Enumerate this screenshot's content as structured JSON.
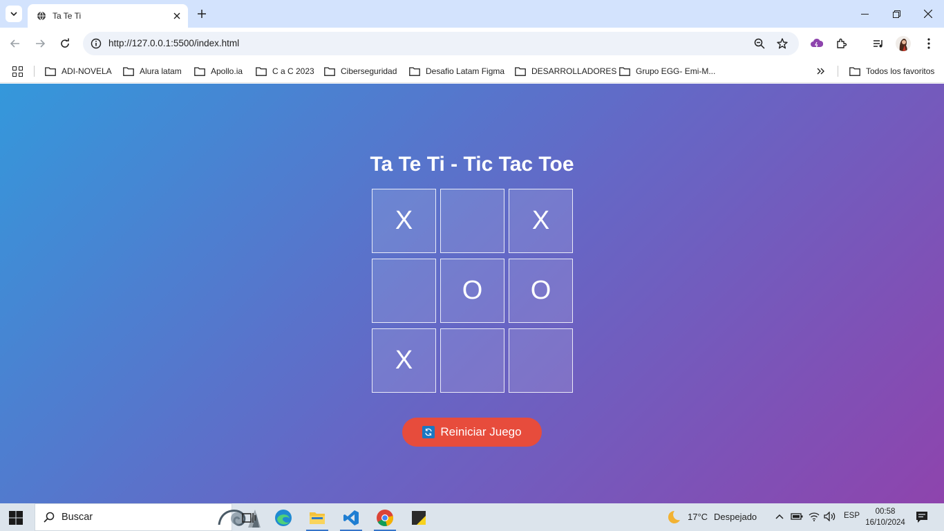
{
  "browser": {
    "tab_title": "Ta Te Ti",
    "url": "http://127.0.0.1:5500/index.html",
    "bookmarks": [
      "ADI-NOVELA",
      "Alura latam",
      "Apollo.ia",
      "C a C 2023",
      "Ciberseguridad",
      "Desafio Latam Figma",
      "DESARROLLADORES",
      "Grupo EGG- Emi-M..."
    ],
    "all_bookmarks": "Todos los favoritos"
  },
  "game": {
    "title": "Ta Te Ti - Tic Tac Toe",
    "cells": [
      "X",
      "",
      "X",
      "",
      "O",
      "O",
      "X",
      "",
      ""
    ],
    "reset_label": "Reiniciar Juego"
  },
  "taskbar": {
    "search_placeholder": "Buscar",
    "weather_temp": "17°C",
    "weather_desc": "Despejado",
    "language": "ESP",
    "time": "00:58",
    "date": "16/10/2024"
  },
  "colors": {
    "gradient_start": "#3498db",
    "gradient_end": "#8e44ad",
    "reset_button": "#e74c3c"
  },
  "icons": {
    "tab": "globe-icon",
    "reset": "refresh-icon",
    "weather": "moon-icon"
  }
}
